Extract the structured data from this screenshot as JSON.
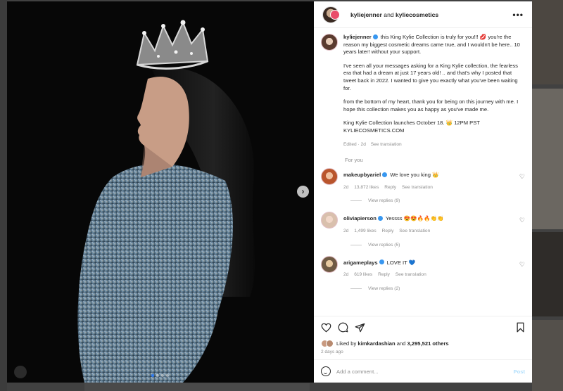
{
  "header": {
    "account": "kyliejenner",
    "conjunction": "and",
    "collab": "kyliecosmetics"
  },
  "caption": {
    "username": "kyliejenner",
    "paragraphs": [
      "this King Kylie Collection is truly for you!!! 💋 you're the reason my biggest cosmetic dreams came true, and I wouldn't be here.. 10 years later! without your support.",
      "I've seen all your messages asking for a King Kylie collection, the fearless era that had a dream at just 17 years old! .. and that's why I posted that tweet back in 2022. I wanted to give you exactly what you've been waiting for.",
      "from the bottom of my heart, thank you for being on this journey with me. I hope this collection makes you as happy as you've made me.",
      "King Kylie Collection launches October 18. 👑 12PM PST KYLIECOSMETICS.COM"
    ],
    "edited": "Edited · 2d",
    "see_translation": "See translation"
  },
  "for_you": "For you",
  "comments": [
    {
      "username": "makeupbyariel",
      "text": "We love you king 👑",
      "time": "2d",
      "likes": "13,872 likes",
      "reply": "Reply",
      "translate": "See translation",
      "view_replies": "View replies (9)"
    },
    {
      "username": "oliviapierson",
      "text": "Yessss 😍😍🔥🔥👏👏",
      "time": "2d",
      "likes": "1,499 likes",
      "reply": "Reply",
      "translate": "See translation",
      "view_replies": "View replies (5)"
    },
    {
      "username": "arigameplays",
      "text": "LOVE IT 💙",
      "time": "2d",
      "likes": "619 likes",
      "reply": "Reply",
      "translate": "See translation",
      "view_replies": "View replies (2)"
    }
  ],
  "likes": {
    "prefix": "Liked by",
    "user": "kimkardashian",
    "and": "and",
    "others": "3,295,521 others"
  },
  "posted_ago": "2 days ago",
  "composer": {
    "placeholder": "Add a comment...",
    "post_label": "Post"
  },
  "carousel": {
    "slide_count": 4,
    "active_index": 0
  },
  "colors": {
    "verified": "#3897f0",
    "post_disabled": "#b2dffc",
    "active_dot": "#2f7bf0"
  },
  "icons": [
    "more-icon",
    "verified-icon",
    "heart-icon",
    "comment-icon",
    "share-icon",
    "bookmark-icon",
    "emoji-icon",
    "chevron-right-icon",
    "user-tag-icon"
  ]
}
